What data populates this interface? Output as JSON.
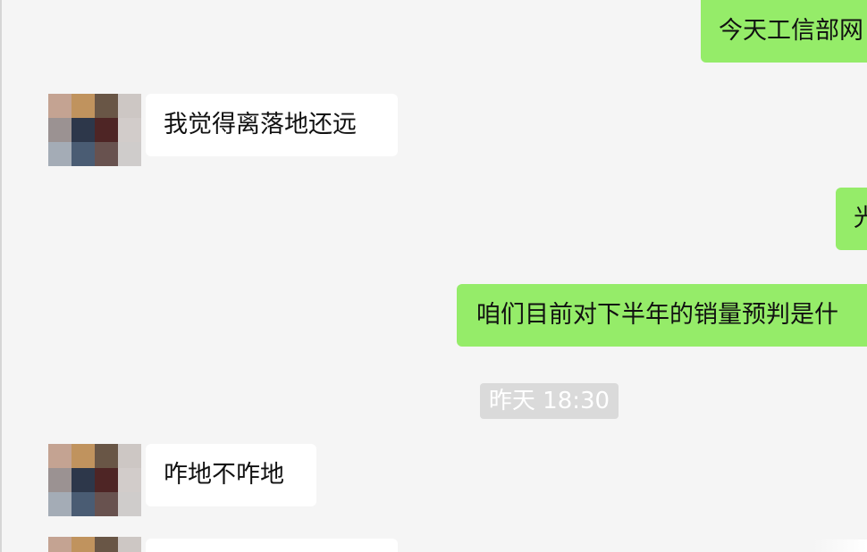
{
  "chat": {
    "messages": [
      {
        "id": "m1",
        "direction": "outgoing",
        "text": "今天工信部网"
      },
      {
        "id": "m2",
        "direction": "incoming",
        "text": "我觉得离落地还远"
      },
      {
        "id": "m3",
        "direction": "outgoing",
        "text": "光"
      },
      {
        "id": "m4",
        "direction": "outgoing",
        "text": "咱们目前对下半年的销量预判是什"
      },
      {
        "id": "m5",
        "direction": "incoming",
        "text": "咋地不咋地"
      },
      {
        "id": "m6",
        "direction": "incoming",
        "text": ""
      }
    ],
    "timestamp": "昨天 18:30"
  },
  "colors": {
    "background": "#f5f5f5",
    "outgoing_bubble": "#95ec69",
    "incoming_bubble": "#ffffff",
    "timestamp_bg": "#dadada",
    "timestamp_text": "#ffffff"
  },
  "avatar_palette": [
    "#c4a392",
    "#c0935e",
    "#695646",
    "#cdc7c4",
    "#9b9292",
    "#2d374a",
    "#4e2525",
    "#d2ccca",
    "#a4acb6",
    "#4a5c73",
    "#68524f",
    "#cfcccb"
  ]
}
